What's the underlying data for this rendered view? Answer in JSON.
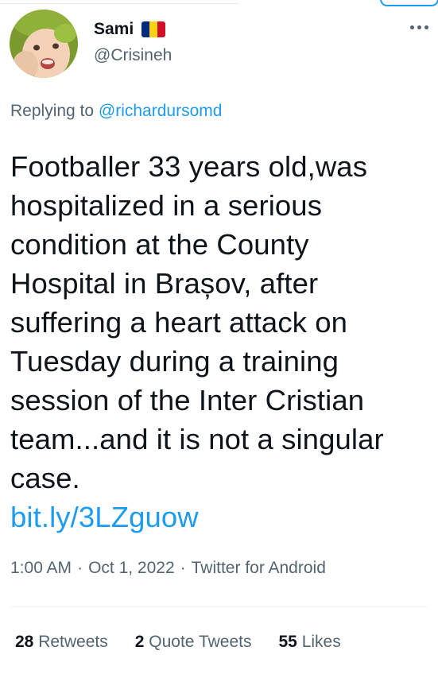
{
  "author": {
    "display_name": "Sami",
    "handle": "@Crisineh",
    "flag_colors": [
      "#002b7f",
      "#fcd116",
      "#ce1126"
    ]
  },
  "menu": {
    "more_icon": "more-horizontal-icon"
  },
  "reply": {
    "prefix": "Replying to",
    "mention": "@richardursomd"
  },
  "tweet": {
    "lines": [
      "Footballer 33 years old,was",
      "hospitalized in a serious",
      "condition at the County",
      "Hospital in Brașov, after",
      "suffering a heart attack on",
      "Tuesday during a training",
      "session of the Inter Cristian",
      "team...and it is not a singular",
      "case."
    ],
    "link": "bit.ly/3LZguow"
  },
  "meta": {
    "time": "1:00 AM",
    "separator": "·",
    "date": "Oct 1, 2022",
    "source": "Twitter for Android"
  },
  "stats": {
    "retweets_count": "28",
    "retweets_label": "Retweets",
    "quotes_count": "2",
    "quotes_label": "Quote Tweets",
    "likes_count": "55",
    "likes_label": "Likes"
  },
  "colors": {
    "accent": "#1d9bf0",
    "text_primary": "#0f1419",
    "text_secondary": "#536471"
  }
}
